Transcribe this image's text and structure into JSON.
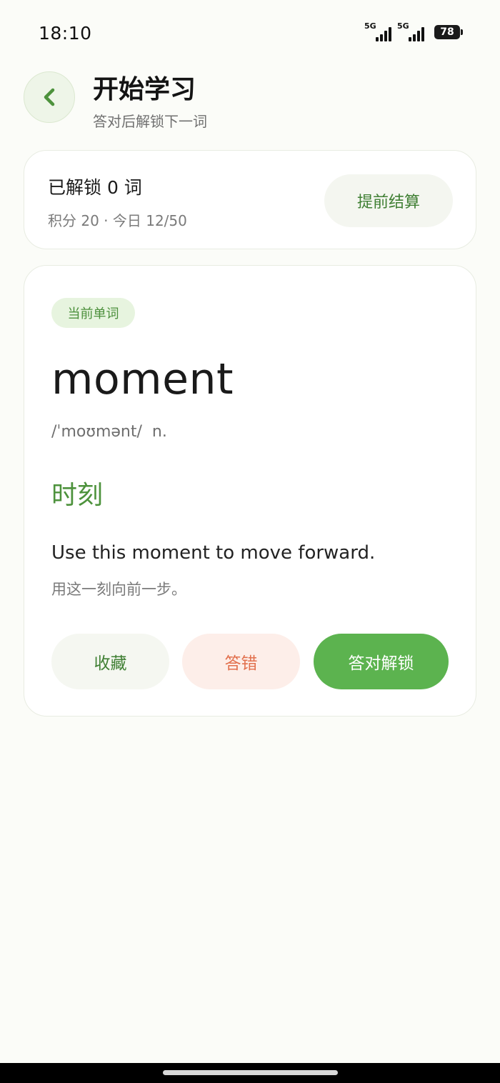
{
  "status_bar": {
    "time": "18:10",
    "network1": "5G",
    "network2": "5G",
    "battery": "78"
  },
  "header": {
    "title": "开始学习",
    "subtitle": "答对后解锁下一词"
  },
  "summary": {
    "unlocked": "已解锁 0 词",
    "stats": "积分 20 · 今日 12/50",
    "settle_label": "提前结算"
  },
  "word_card": {
    "tag": "当前单词",
    "word": "moment",
    "phonetic": "/ˈmoʊmənt/  n.",
    "meaning": "时刻",
    "example_en": "Use this moment to move forward.",
    "example_zh": "用这一刻向前一步。",
    "favorite_label": "收藏",
    "wrong_label": "答错",
    "correct_label": "答对解锁"
  },
  "colors": {
    "accent": "#5cb34f",
    "accent_text": "#3f7f33",
    "wrong": "#e2704d",
    "background": "#fbfcf8"
  }
}
